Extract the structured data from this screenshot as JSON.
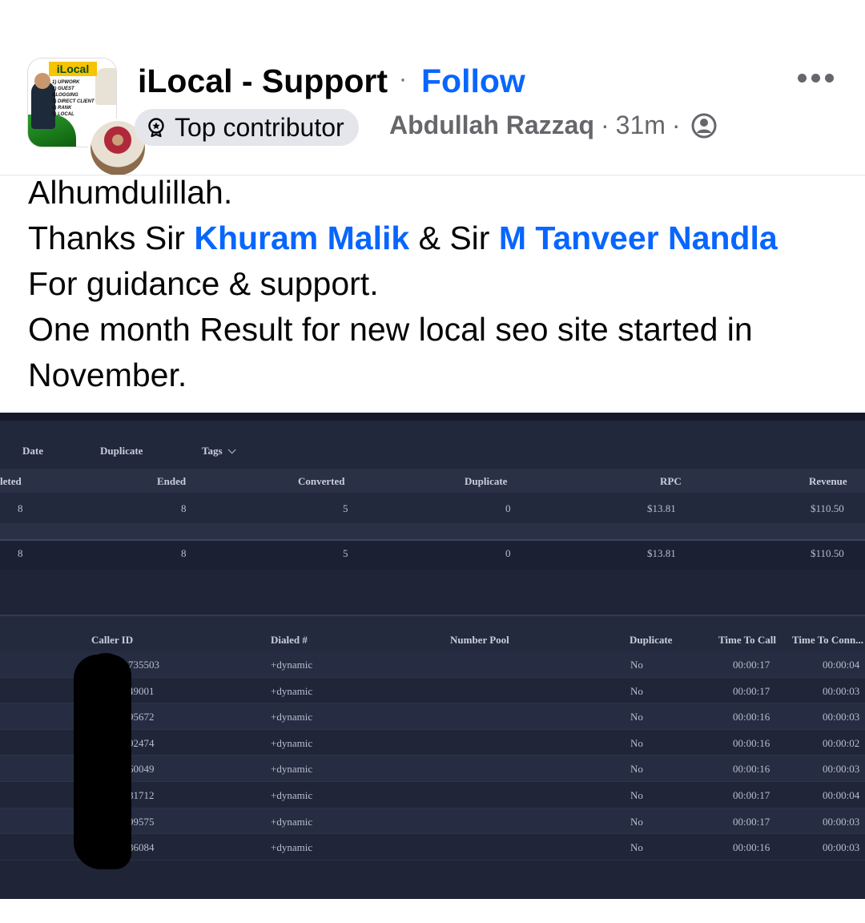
{
  "post": {
    "page_name": "iLocal - Support",
    "separator": "·",
    "follow_label": "Follow",
    "badge_label": "Top contributor",
    "author": "Abdullah Razzaq",
    "time": "31m",
    "avatar_logo_text": "iLocal",
    "avatar_lines": [
      "1) UPWORK",
      "2) GUEST BLOGGING",
      "3) DIRECT CLIENT",
      "4) RANK",
      "5) LOCAL"
    ],
    "icons": {
      "more": "more-horizontal-icon",
      "badge": "contributor-badge-icon",
      "audience": "globe-icon"
    },
    "text": {
      "line1": "Alhumdulillah.",
      "line2_a": "Thanks Sir ",
      "mention1": "Khuram Malik",
      "line2_b": " & Sir ",
      "mention2": "M Tanveer Nandla",
      "line3": "For guidance & support.",
      "line4": "One month Result for new local seo site started in November."
    },
    "colors": {
      "link": "#0866ff",
      "meta": "#65676b",
      "badge_bg": "#e4e6eb"
    }
  },
  "screenshot": {
    "filters": {
      "date": "Date",
      "duplicate": "Duplicate",
      "tags": "Tags"
    },
    "summary": {
      "headers": [
        "leted",
        "Ended",
        "Converted",
        "Duplicate",
        "RPC",
        "Revenue"
      ],
      "rows": [
        [
          "8",
          "8",
          "5",
          "0",
          "$13.81",
          "$110.50"
        ],
        [
          "8",
          "8",
          "5",
          "0",
          "$13.81",
          "$110.50"
        ]
      ]
    },
    "calls": {
      "headers": [
        "Caller ID",
        "Dialed #",
        "Number Pool",
        "Duplicate",
        "Time To Call",
        "Time To Conn..."
      ],
      "rows": [
        [
          "735503",
          "+dynamic",
          "No",
          "00:00:17",
          "00:00:04"
        ],
        [
          "49001",
          "+dynamic",
          "No",
          "00:00:17",
          "00:00:03"
        ],
        [
          "95672",
          "+dynamic",
          "No",
          "00:00:16",
          "00:00:03"
        ],
        [
          "92474",
          "+dynamic",
          "No",
          "00:00:16",
          "00:00:02"
        ],
        [
          "60049",
          "+dynamic",
          "No",
          "00:00:16",
          "00:00:03"
        ],
        [
          "81712",
          "+dynamic",
          "No",
          "00:00:17",
          "00:00:04"
        ],
        [
          "99575",
          "+dynamic",
          "No",
          "00:00:17",
          "00:00:03"
        ],
        [
          "36084",
          "+dynamic",
          "No",
          "00:00:16",
          "00:00:03"
        ]
      ]
    }
  }
}
